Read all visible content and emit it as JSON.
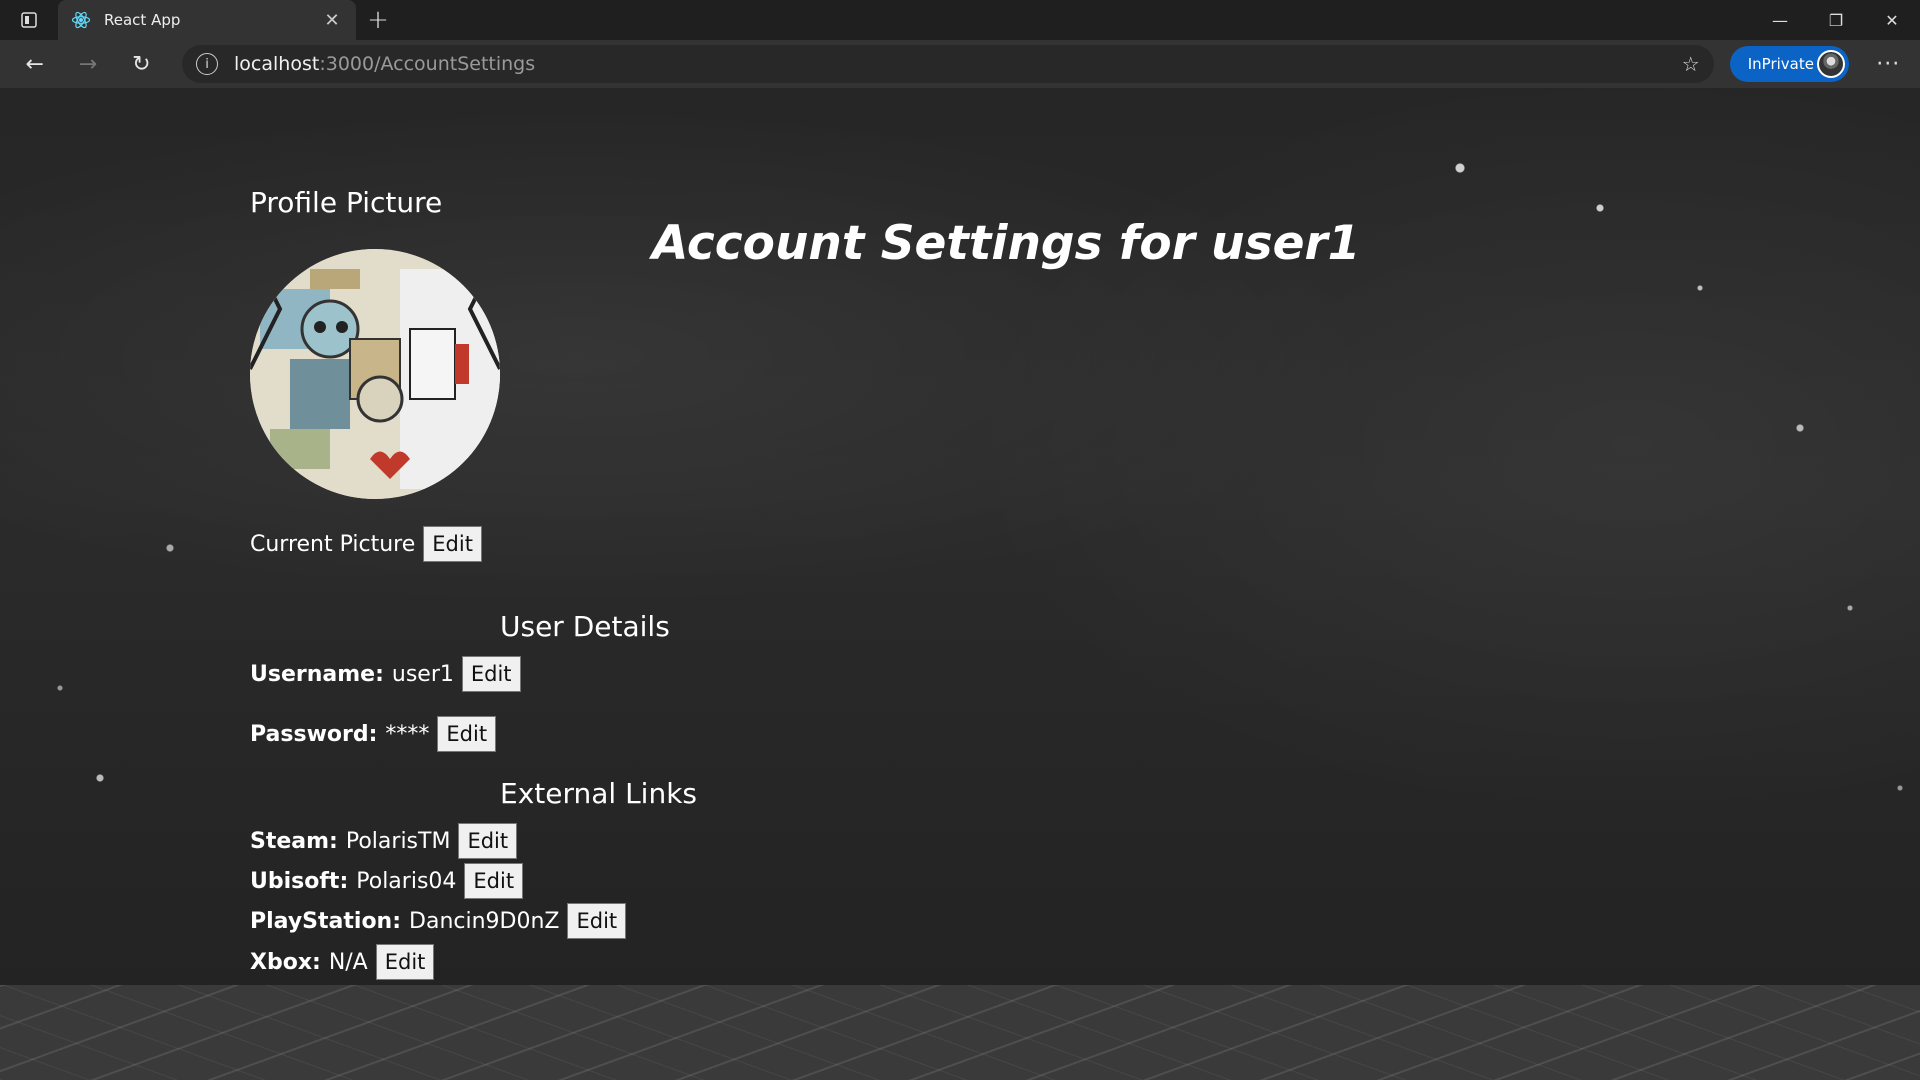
{
  "browser": {
    "tab_title": "React App",
    "url_host": "localhost",
    "url_path": ":3000/AccountSettings",
    "inprivate_label": "InPrivate"
  },
  "page": {
    "title": "Account Settings for user1",
    "profile": {
      "heading": "Profile Picture",
      "current_label": "Current Picture",
      "edit_label": "Edit"
    },
    "user_details": {
      "heading": "User Details",
      "username_label": "Username:",
      "username_value": "user1",
      "password_label": "Password:",
      "password_value": "****",
      "edit_label": "Edit"
    },
    "external_links": {
      "heading": "External Links",
      "items": [
        {
          "label": "Steam:",
          "value": "PolarisTM",
          "edit": "Edit"
        },
        {
          "label": "Ubisoft:",
          "value": "Polaris04",
          "edit": "Edit"
        },
        {
          "label": "PlayStation:",
          "value": "Dancin9D0nZ",
          "edit": "Edit"
        },
        {
          "label": "Xbox:",
          "value": "N/A",
          "edit": "Edit"
        }
      ]
    }
  },
  "icons": [
    "tab-actions-icon",
    "react-logo-icon",
    "close-icon",
    "plus-icon",
    "minimize-icon",
    "restore-icon",
    "window-close-icon",
    "back-arrow-icon",
    "forward-arrow-icon",
    "refresh-icon",
    "info-icon",
    "favorites-star-icon",
    "more-icon"
  ]
}
